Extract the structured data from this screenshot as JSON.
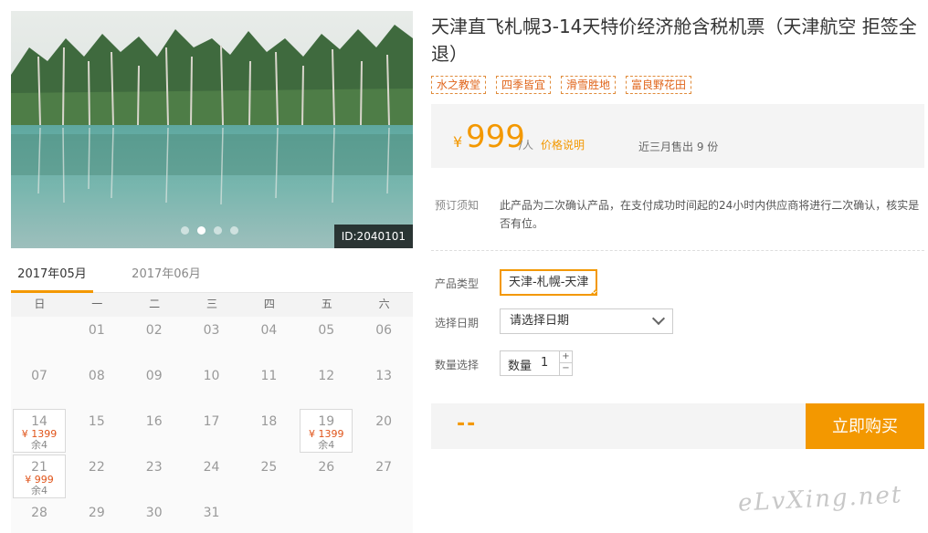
{
  "photo": {
    "id_label": "ID:2040101",
    "dots": 4,
    "active_dot": 1
  },
  "product": {
    "title": "天津直飞札幌3-14天特价经济舱含税机票（天津航空 拒签全退）",
    "tags": [
      "水之教堂",
      "四季皆宜",
      "滑雪胜地",
      "富良野花田"
    ]
  },
  "price": {
    "currency": "¥",
    "amount": "999",
    "unit": "/人",
    "explain_link": "价格说明",
    "sold": "近三月售出 9 份"
  },
  "notice": {
    "label": "预订须知",
    "text": "此产品为二次确认产品，在支付成功时间起的24小时内供应商将进行二次确认，核实是否有位。"
  },
  "form": {
    "type_label": "产品类型",
    "type_value": "天津-札幌-天津",
    "date_label": "选择日期",
    "date_value": "请选择日期",
    "qty_label": "数量选择",
    "qty_field_label": "数量",
    "qty_value": "1",
    "plus": "+",
    "minus": "−"
  },
  "buy": {
    "total": "--",
    "button": "立即购买"
  },
  "calendar": {
    "tabs": [
      "2017年05月",
      "2017年06月"
    ],
    "weekdays": [
      "日",
      "一",
      "二",
      "三",
      "四",
      "五",
      "六"
    ],
    "first_weekday": 1,
    "days": 31,
    "available": {
      "14": {
        "price": "¥ 1399",
        "remain": "余4"
      },
      "19": {
        "price": "¥ 1399",
        "remain": "余4"
      },
      "21": {
        "price": "¥ 999",
        "remain": "余4"
      }
    }
  },
  "watermark": "eLvXing.net",
  "colors": {
    "accent": "#f39800",
    "price_red": "#e0541a"
  }
}
